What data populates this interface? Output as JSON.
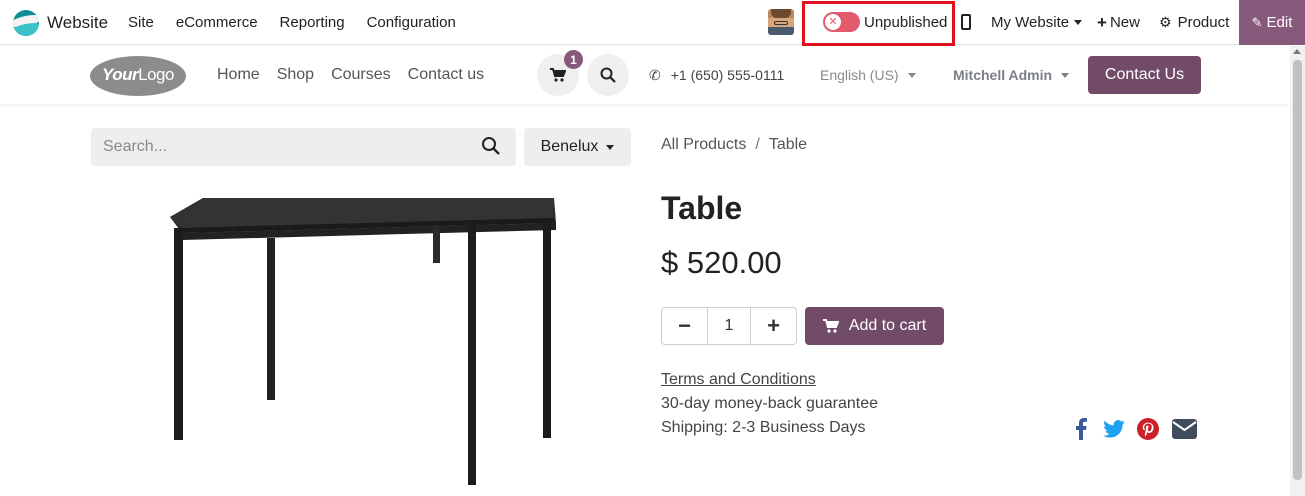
{
  "topbar": {
    "app_name": "Website",
    "menu": [
      "Site",
      "eCommerce",
      "Reporting",
      "Configuration"
    ],
    "publish_status": "Unpublished",
    "website_selector": "My Website",
    "new_label": "New",
    "product_label": "Product",
    "edit_label": "Edit"
  },
  "header": {
    "logo_your": "Your",
    "logo_logo": "Logo",
    "nav": [
      "Home",
      "Shop",
      "Courses",
      "Contact us"
    ],
    "cart_count": "1",
    "phone": "+1 (650) 555-0111",
    "language": "English (US)",
    "user": "Mitchell Admin",
    "contact_button": "Contact Us"
  },
  "search": {
    "placeholder": "Search...",
    "pricelist": "Benelux"
  },
  "breadcrumb": {
    "parent": "All Products",
    "separator": "/",
    "current": "Table"
  },
  "product": {
    "name": "Table",
    "price": "$ 520.00",
    "quantity": "1",
    "add_to_cart": "Add to cart",
    "terms": "Terms and Conditions",
    "guarantee": "30-day money-back guarantee",
    "shipping": "Shipping: 2-3 Business Days"
  },
  "colors": {
    "brand": "#714b67",
    "edit_bg": "#875a7b",
    "toggle_off": "#e25b6c",
    "highlight": "#e0101f",
    "facebook": "#3b5998",
    "twitter": "#1da1f2",
    "pinterest": "#cb2027",
    "email": "#3f4c5c"
  },
  "icons": [
    "odoo-website-icon",
    "toggle-off-icon",
    "mobile-icon",
    "caret-down-icon",
    "plus-icon",
    "gear-icon",
    "pencil-icon",
    "cart-icon",
    "search-icon",
    "phone-icon",
    "minus-icon",
    "facebook-icon",
    "twitter-icon",
    "pinterest-icon",
    "envelope-icon"
  ]
}
